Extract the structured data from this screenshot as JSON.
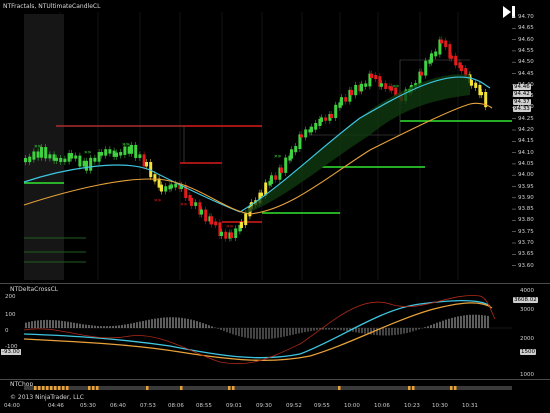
{
  "main_panel": {
    "title": "NTFractals, NTUltimateCandleCL",
    "price_ticks": [
      "94.70",
      "94.65",
      "94.60",
      "94.55",
      "94.50",
      "94.45",
      "94.40",
      "94.35",
      "94.30",
      "94.25",
      "94.20",
      "94.15",
      "94.10",
      "94.05",
      "94.00",
      "93.95",
      "93.90",
      "93.85",
      "93.80",
      "93.75",
      "93.70",
      "93.65",
      "93.60"
    ],
    "price_tags": [
      "94.46",
      "94.42",
      "94.37",
      "94.33"
    ]
  },
  "delta_panel": {
    "title": "NTDeltaCrossCL",
    "left_ticks": [
      "200",
      "100",
      "0",
      "-100"
    ],
    "left_tag": "-93.00",
    "right_ticks": [
      "4000",
      "3000",
      "2000",
      "1000"
    ],
    "right_tags": [
      "3608.02",
      "1500"
    ]
  },
  "chop_panel": {
    "title": "NTChop",
    "copyright": "© 2013 NinjaTrader, LLC"
  },
  "time_axis": [
    "04:00",
    "04:46",
    "05:30",
    "06:40",
    "07:53",
    "08:06",
    "08:55",
    "09:01",
    "09:30",
    "09:52",
    "09:55",
    "10:00",
    "10:06",
    "10:23",
    "10:30",
    "10:31"
  ],
  "colors": {
    "up": "#3fd13f",
    "down": "#e01c1c",
    "neutral": "#f3e23a",
    "ema_fast": "#3ec6e0",
    "ema_slow": "#e8a23a",
    "green_line": "#31e531",
    "red_line": "#d91a1a"
  },
  "icons": {
    "play": "play-pause-icon"
  }
}
